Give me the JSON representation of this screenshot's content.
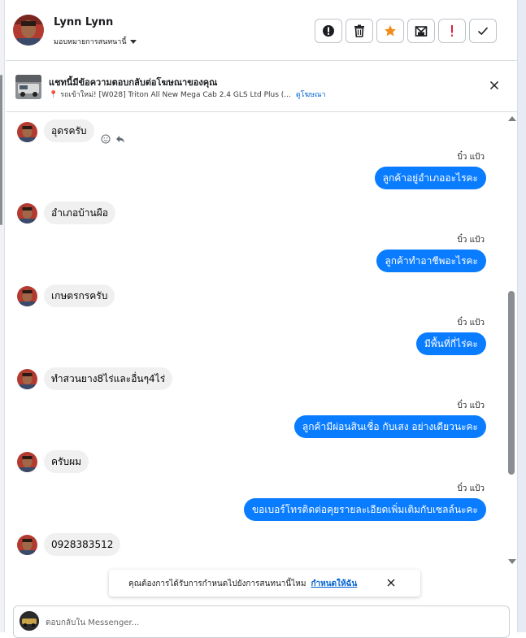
{
  "contact": {
    "name": "Lynn Lynn",
    "assign_label": "มอบหมายการสนทนานี้"
  },
  "actions": [
    {
      "name": "mark-spam-button",
      "icon": "alert-circle-icon"
    },
    {
      "name": "delete-button",
      "icon": "trash-icon"
    },
    {
      "name": "star-button",
      "icon": "star-icon"
    },
    {
      "name": "mark-unread-button",
      "icon": "envelope-icon"
    },
    {
      "name": "follow-up-button",
      "icon": "exclamation-icon"
    },
    {
      "name": "mark-done-button",
      "icon": "checkmark-icon"
    }
  ],
  "ad": {
    "title": "แชทนี้มีข้อความตอบกลับต่อโฆษณาของคุณ",
    "subtitle": "รถเข้าใหม่! [W028] Triton All New Mega Cab 2.4 GLS Ltd Plus (...",
    "view_link": "ดูโฆษณา"
  },
  "messages": [
    {
      "dir": "in",
      "text": "อุดรครับ"
    },
    {
      "dir": "out",
      "sender": "บิ๋ว แป้ว",
      "text": "ลูกค้าอยู่อำเภออะไรคะ"
    },
    {
      "dir": "in",
      "text": "อำเภอบ้านผือ"
    },
    {
      "dir": "out",
      "sender": "บิ๋ว แป้ว",
      "text": "ลูกค้าทำอาชีพอะไรคะ"
    },
    {
      "dir": "in",
      "text": "เกษตรกรครับ"
    },
    {
      "dir": "out",
      "sender": "บิ๋ว แป้ว",
      "text": "มีพื้นที่กี่ไร่คะ"
    },
    {
      "dir": "in",
      "text": "ทำสวนยาง8ไร่และอื่นๆ4ไร่"
    },
    {
      "dir": "out",
      "sender": "บิ๋ว แป้ว",
      "text": "ลูกค้ามีผ่อนสินเชื่อ กับเสง อย่างเดียวนะคะ"
    },
    {
      "dir": "in",
      "text": "ครับผม"
    },
    {
      "dir": "out",
      "sender": "บิ๋ว แป้ว",
      "text": "ขอเบอร์โทรติดต่อคุยรายละเอียดเพิ่มเติมกับเซลล์นะคะ"
    },
    {
      "dir": "in",
      "text": "0928383512"
    }
  ],
  "notification": {
    "text": "คุณต้องการได้รับการกำหนดไปยังการสนทนานี้ไหม",
    "link": "กำหนดให้ฉัน"
  },
  "composer": {
    "placeholder": "ตอบกลับใน Messenger..."
  },
  "colors": {
    "outgoing_bubble": "#0a7cff",
    "incoming_bubble": "#f0f0f0",
    "star": "#f28c18",
    "alert": "#e41e3f",
    "link": "#0064d1"
  }
}
